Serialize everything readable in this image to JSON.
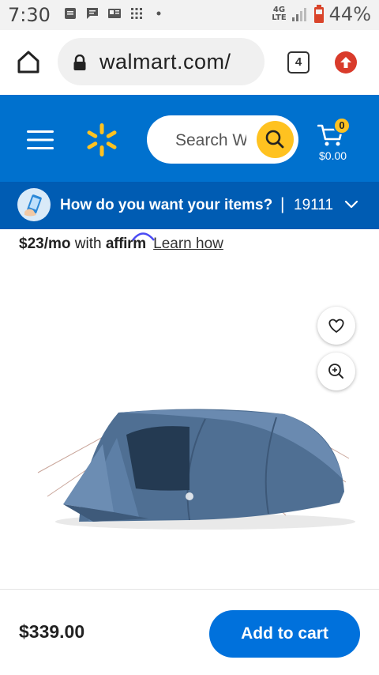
{
  "status_bar": {
    "time": "7:30",
    "network_label_top": "4G",
    "network_label_bottom": "LTE",
    "battery": "44%"
  },
  "browser": {
    "url": "walmart.com/",
    "tab_count": "4",
    "icons": [
      "home-icon",
      "lock-icon",
      "tabs-icon",
      "update-icon"
    ]
  },
  "header": {
    "search_placeholder": "Search Walmart",
    "cart_count": "0",
    "cart_total": "$0.00",
    "brand_color": "#0071ce",
    "accent_color": "#ffc220"
  },
  "delivery": {
    "question": "How do you want your items?",
    "separator": "|",
    "zip": "19111"
  },
  "affirm": {
    "price": "$23/mo",
    "with": "with",
    "brand": "affirm",
    "link": "Learn how"
  },
  "product": {
    "price": "$339.00",
    "add_to_cart_label": "Add to cart"
  }
}
